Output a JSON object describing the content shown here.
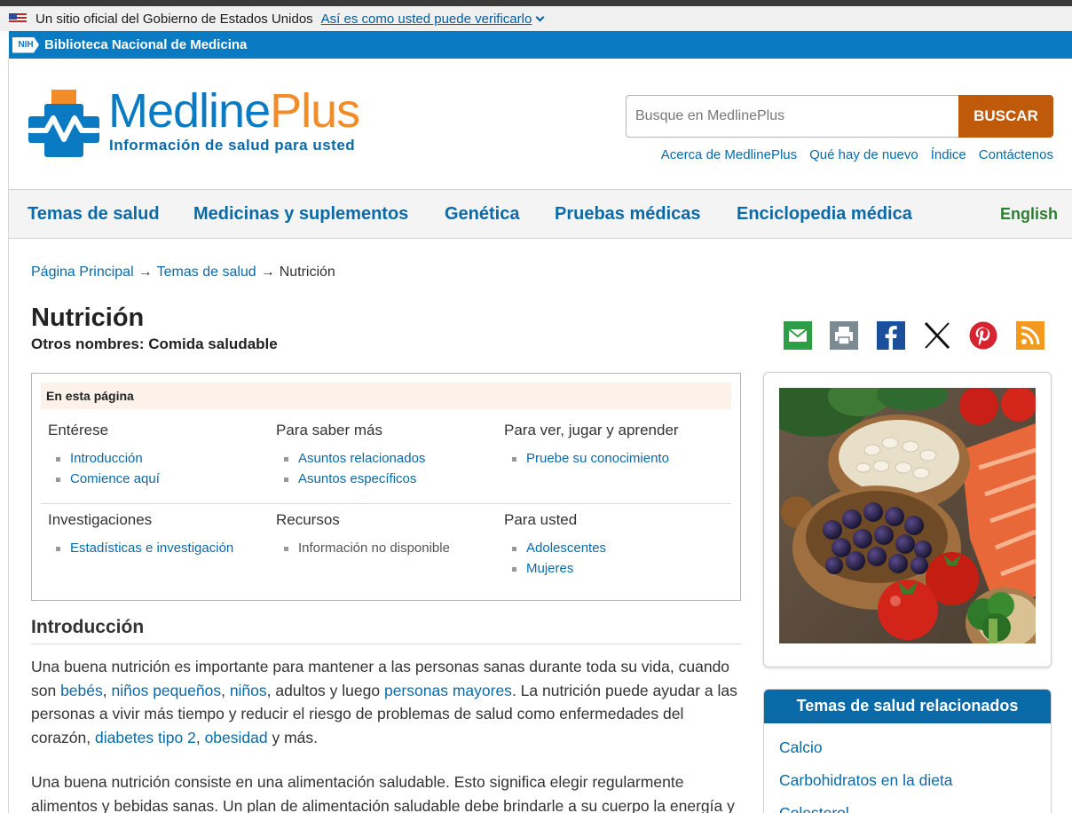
{
  "gov_banner": {
    "text": "Un sitio oficial del Gobierno de Estados Unidos",
    "link": "Así es como usted puede verificarlo"
  },
  "nlm_bar": {
    "badge": "NIH",
    "title": "Biblioteca Nacional de Medicina"
  },
  "logo": {
    "name_part1": "Medline",
    "name_part2": "Plus",
    "tagline": "Información de salud para usted"
  },
  "search": {
    "placeholder": "Busque en MedlinePlus",
    "button": "BUSCAR"
  },
  "util_links": [
    "Acerca de MedlinePlus",
    "Qué hay de nuevo",
    "Índice",
    "Contáctenos"
  ],
  "nav": {
    "items": [
      "Temas de salud",
      "Medicinas y suplementos",
      "Genética",
      "Pruebas médicas",
      "Enciclopedia médica"
    ],
    "language": "English"
  },
  "breadcrumb": {
    "home": "Página Principal",
    "section": "Temas de salud",
    "arrow": "→",
    "current": "Nutrición"
  },
  "page": {
    "title": "Nutrición",
    "other_names": "Otros nombres: Comida saludable"
  },
  "share_icons": [
    "email-icon",
    "print-icon",
    "facebook-icon",
    "x-icon",
    "pinterest-icon",
    "rss-icon"
  ],
  "colors": {
    "brand_blue": "#0a7ac2",
    "link": "#0a6aa8",
    "search_button": "#c05a0b",
    "english_green": "#2e7d32",
    "toc_header_bg": "#fcf2ea"
  },
  "toc": {
    "title": "En esta página",
    "sections": [
      {
        "heading": "Entérese",
        "links": [
          "Introducción",
          "Comience aquí"
        ]
      },
      {
        "heading": "Para saber más",
        "links": [
          "Asuntos relacionados",
          "Asuntos específicos"
        ]
      },
      {
        "heading": "Para ver, jugar y aprender",
        "links": [
          "Pruebe su conocimiento"
        ]
      },
      {
        "heading": "Investigaciones",
        "links": [
          "Estadísticas e investigación"
        ]
      },
      {
        "heading": "Recursos",
        "unavailable": "Información no disponible"
      },
      {
        "heading": "Para usted",
        "links": [
          "Adolescentes",
          "Mujeres"
        ]
      }
    ]
  },
  "intro": {
    "heading": "Introducción",
    "p1": {
      "t1": "Una buena nutrición es importante para mantener a las personas sanas durante toda su vida, cuando son ",
      "l1": "bebés",
      "t2": ", ",
      "l2": "niños pequeños",
      "t3": ", ",
      "l3": "niños",
      "t4": ", adultos y luego ",
      "l4": "personas mayores",
      "t5": ". La nutrición puede ayudar a las personas a vivir más tiempo y reducir el riesgo de problemas de salud como enfermedades del corazón, ",
      "l5": "diabetes tipo 2",
      "t6": ", ",
      "l6": "obesidad",
      "t7": " y más."
    },
    "p2": "Una buena nutrición consiste en una alimentación saludable. Esto significa elegir regularmente alimentos y bebidas sanas. Un plan de alimentación saludable debe brindarle a su cuerpo la energía y"
  },
  "related": {
    "title": "Temas de salud relacionados",
    "items": [
      "Calcio",
      "Carbohidratos en la dieta",
      "Colesterol"
    ]
  }
}
